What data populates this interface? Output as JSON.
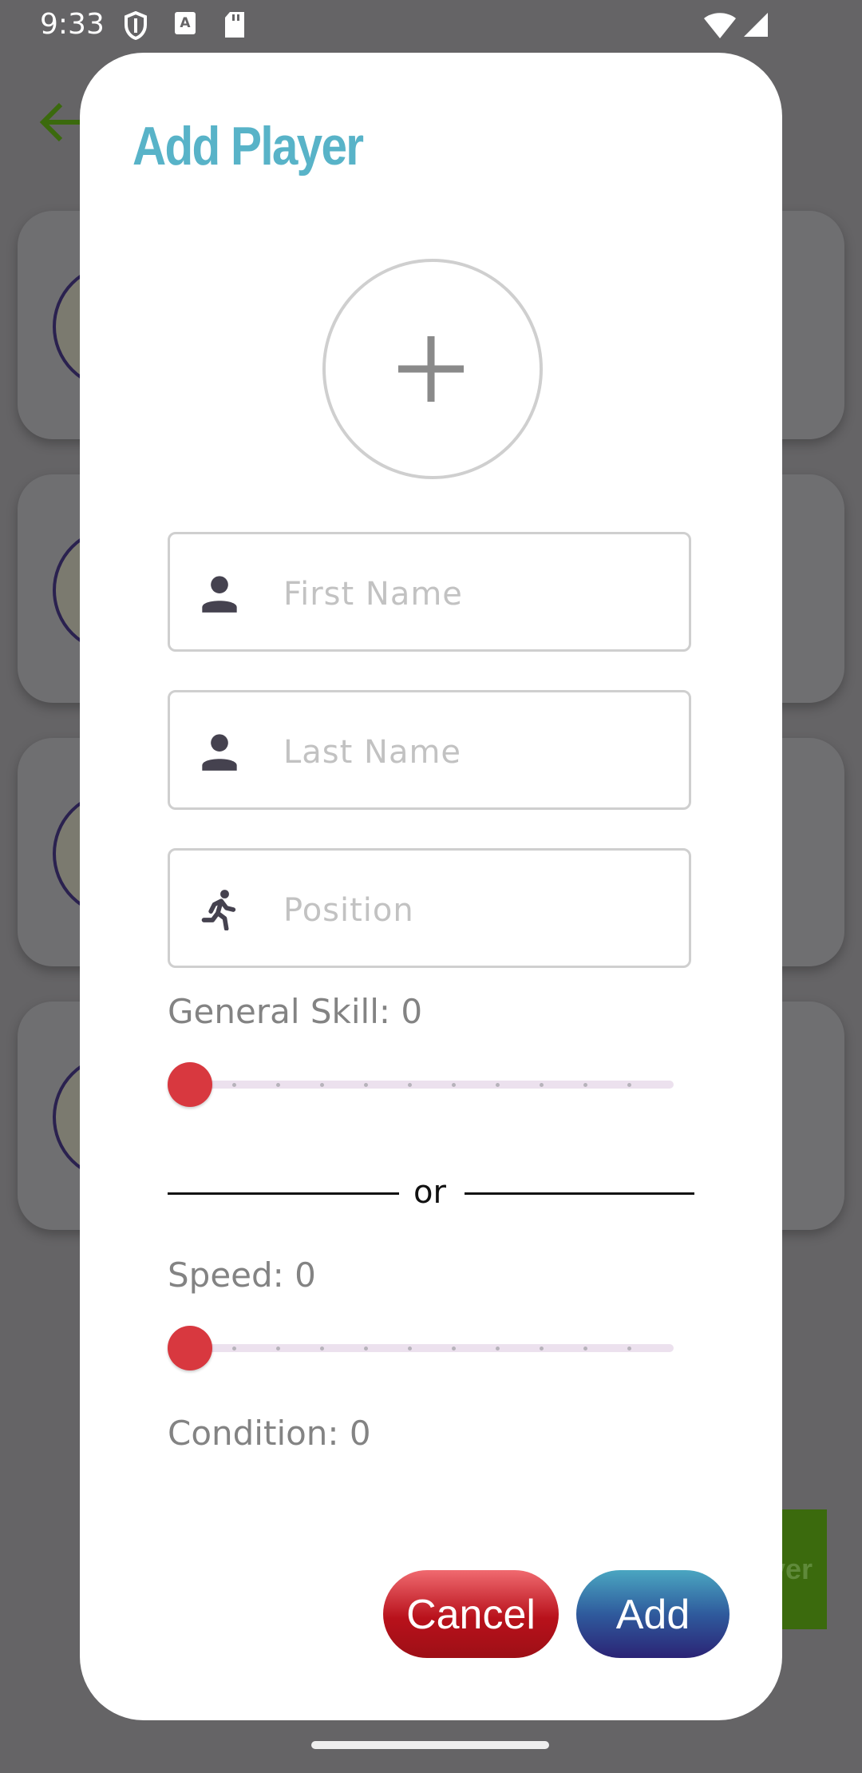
{
  "status_bar": {
    "time": "9:33"
  },
  "dialog": {
    "title": "Add Player",
    "fields": {
      "first_name": {
        "value": "",
        "placeholder": "First Name"
      },
      "last_name": {
        "value": "",
        "placeholder": "Last Name"
      },
      "position": {
        "value": "",
        "placeholder": "Position"
      }
    },
    "general_skill": {
      "label": "General Skill: 0",
      "value": 0,
      "max": 10
    },
    "separator": "or",
    "speed": {
      "label": "Speed: 0",
      "value": 0,
      "max": 10
    },
    "condition": {
      "label": "Condition: 0",
      "value": 0
    },
    "buttons": {
      "cancel": "Cancel",
      "add": "Add"
    }
  },
  "background": {
    "fab_label_partial": "yer"
  },
  "colors": {
    "title": "#58b3c8",
    "slider_thumb": "#d8383f",
    "cancel_button": "#b8111b",
    "add_button": "#2f5b9d",
    "back_arrow": "#3b6a0d"
  }
}
